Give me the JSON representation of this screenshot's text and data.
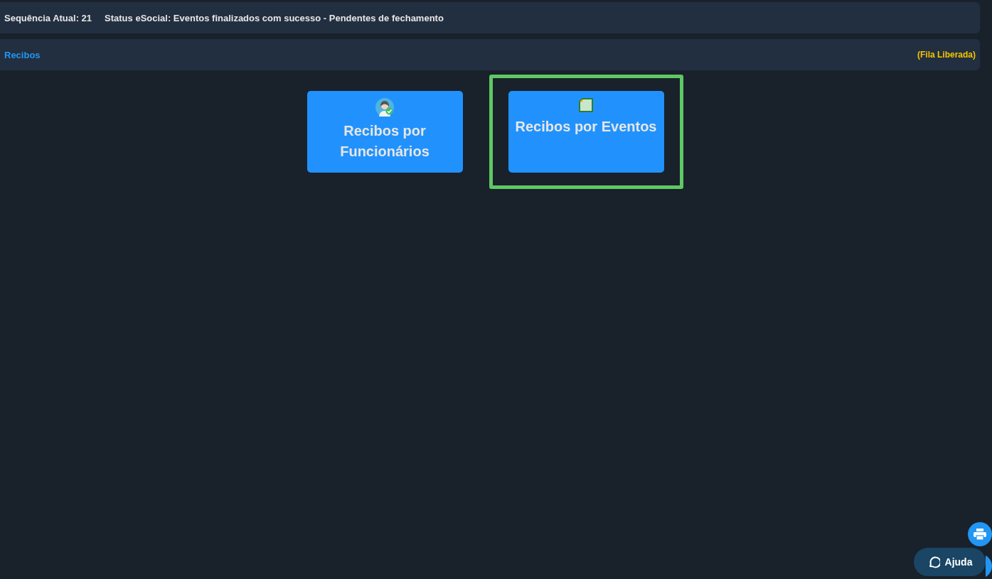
{
  "status_bar": {
    "sequence": "Sequência Atual: 21",
    "status": "Status eSocial: Eventos finalizados com sucesso - Pendentes de fechamento"
  },
  "section": {
    "title": "Recibos",
    "queue": "(Fila Liberada)"
  },
  "cards": [
    {
      "label": "Recibos por Funcionários",
      "kind": "employee",
      "selected": false
    },
    {
      "label": "Recibos por Eventos",
      "kind": "document",
      "selected": true
    }
  ],
  "help_button": {
    "label": "Ajuda"
  }
}
